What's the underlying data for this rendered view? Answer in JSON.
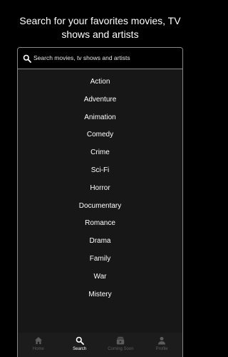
{
  "header": {
    "title": "Search for your favorites movies, TV shows and artists"
  },
  "search": {
    "placeholder": "Search movies, tv shows and artists",
    "value": ""
  },
  "genres": [
    "Action",
    "Adventure",
    "Animation",
    "Comedy",
    "Crime",
    "Sci-Fi",
    "Horror",
    "Documentary",
    "Romance",
    "Drama",
    "Family",
    "War",
    "Mistery"
  ],
  "nav": {
    "items": [
      {
        "label": "Home",
        "icon": "home-icon",
        "active": false
      },
      {
        "label": "Search",
        "icon": "search-icon",
        "active": true
      },
      {
        "label": "Coming Soon",
        "icon": "video-library-icon",
        "active": false
      },
      {
        "label": "Profile",
        "icon": "person-icon",
        "active": false
      }
    ]
  },
  "colors": {
    "background": "#000000",
    "panel": "#171717",
    "nav_background": "#1c1c1c",
    "active": "#ffffff",
    "inactive": "#5c5c5c",
    "border": "#8a8a8a"
  }
}
